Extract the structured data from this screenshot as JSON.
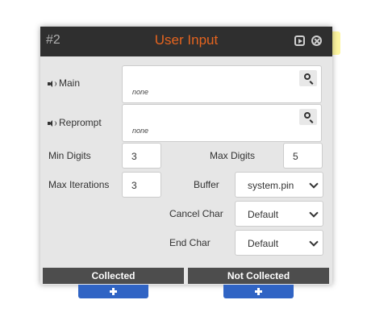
{
  "node": {
    "id_label": "#2",
    "title": "User Input",
    "accent_color": "#e5641f",
    "header_icons": [
      "play-icon",
      "close-icon"
    ]
  },
  "prompts": {
    "main": {
      "label": "Main",
      "value": "none",
      "icon": "speaker-icon",
      "action_icon": "search-icon"
    },
    "reprompt": {
      "label": "Reprompt",
      "value": "none",
      "icon": "speaker-icon",
      "action_icon": "search-icon"
    }
  },
  "fields": {
    "min_digits": {
      "label": "Min Digits",
      "value": "3"
    },
    "max_digits": {
      "label": "Max Digits",
      "value": "5"
    },
    "max_iterations": {
      "label": "Max Iterations",
      "value": "3"
    },
    "buffer": {
      "label": "Buffer",
      "value": "system.pin"
    },
    "cancel_char": {
      "label": "Cancel Char",
      "value": "Default"
    },
    "end_char": {
      "label": "End Char",
      "value": "Default"
    }
  },
  "paths": {
    "collected": "Collected",
    "not_collected": "Not Collected",
    "add_button_color": "#3064c4"
  }
}
